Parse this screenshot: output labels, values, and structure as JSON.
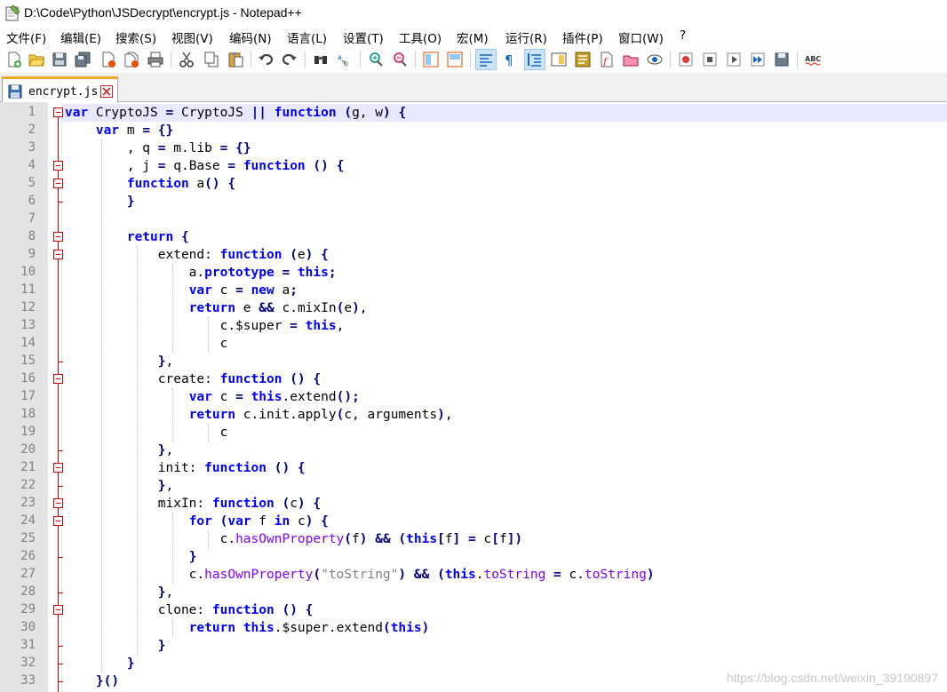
{
  "window": {
    "title": "D:\\Code\\Python\\JSDecrypt\\encrypt.js - Notepad++"
  },
  "menu": [
    {
      "label": "文件(F)"
    },
    {
      "label": "编辑(E)"
    },
    {
      "label": "搜索(S)"
    },
    {
      "label": "视图(V)"
    },
    {
      "label": "编码(N)"
    },
    {
      "label": "语言(L)"
    },
    {
      "label": "设置(T)"
    },
    {
      "label": "工具(O)"
    },
    {
      "label": "宏(M)"
    },
    {
      "label": "运行(R)"
    },
    {
      "label": "插件(P)"
    },
    {
      "label": "窗口(W)"
    },
    {
      "label": "?"
    }
  ],
  "toolbar": {
    "icons": [
      "new-file-icon",
      "open-file-icon",
      "save-icon",
      "save-all-icon",
      "close-icon",
      "close-all-icon",
      "print-icon",
      "cut-icon",
      "copy-icon",
      "paste-icon",
      "undo-icon",
      "redo-icon",
      "find-icon",
      "replace-icon",
      "zoom-in-icon",
      "zoom-out-icon",
      "sync-vertical-icon",
      "sync-horizontal-icon",
      "word-wrap-icon",
      "show-all-chars-icon",
      "indent-guide-icon",
      "document-map-icon",
      "function-list-icon",
      "folder-workspace-icon",
      "monitoring-icon",
      "record-macro-icon",
      "stop-macro-icon",
      "play-macro-icon",
      "run-macro-multiple-icon",
      "save-macro-icon",
      "spell-check-icon"
    ]
  },
  "tab": {
    "label": "encrypt.js"
  },
  "editor": {
    "line_numbers": [
      "1",
      "2",
      "3",
      "4",
      "5",
      "6",
      "7",
      "8",
      "9",
      "10",
      "11",
      "12",
      "13",
      "14",
      "15",
      "16",
      "17",
      "18",
      "19",
      "20",
      "21",
      "22",
      "23",
      "24",
      "25",
      "26",
      "27",
      "28",
      "29",
      "30",
      "31",
      "32",
      "33"
    ],
    "lines": [
      "var CryptoJS = CryptoJS || function (g, w) {",
      "    var m = {}",
      "        , q = m.lib = {}",
      "        , j = q.Base = function () {",
      "        function a() {",
      "        }",
      "",
      "        return {",
      "            extend: function (e) {",
      "                a.prototype = this;",
      "                var c = new a;",
      "                return e && c.mixIn(e),",
      "                    c.$super = this,",
      "                    c",
      "            },",
      "            create: function () {",
      "                var c = this.extend();",
      "                return c.init.apply(c, arguments),",
      "                    c",
      "            },",
      "            init: function () {",
      "            },",
      "            mixIn: function (c) {",
      "                for (var f in c) {",
      "                    c.hasOwnProperty(f) && (this[f] = c[f])",
      "                }",
      "                c.hasOwnProperty(\"toString\") && (this.toString = c.toString)",
      "            },",
      "            clone: function () {",
      "                return this.$super.extend(this)",
      "            }",
      "        }",
      "    }()"
    ],
    "fold_lines": [
      1,
      4,
      5,
      8,
      9,
      16,
      21,
      23,
      24,
      29
    ]
  },
  "watermark": "https://blog.csdn.net/weixin_39190897",
  "colors": {
    "keyword": "#0000ff",
    "operator": "#000080",
    "method": "#8000ff",
    "string": "#808080",
    "fold_marker": "#d00000",
    "current_line": "#e8e8ff",
    "tab_accent": "#f5a623"
  }
}
